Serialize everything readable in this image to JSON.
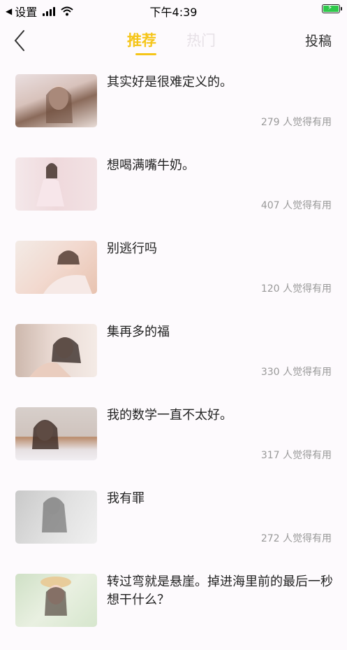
{
  "status_bar": {
    "back_app": "设置",
    "time": "下午4:39",
    "back_arrow": "◀"
  },
  "nav": {
    "tabs": [
      {
        "label": "推荐",
        "active": true
      },
      {
        "label": "热门",
        "active": false
      }
    ],
    "submit_label": "投稿",
    "back_icon": "chevron-left-icon",
    "accent_color": "#f5c518"
  },
  "posts": [
    {
      "title": "其实好是很难定义的。",
      "likes": "279 人觉得有用"
    },
    {
      "title": "想喝满嘴牛奶。",
      "likes": "407 人觉得有用"
    },
    {
      "title": "别逃行吗",
      "likes": "120 人觉得有用"
    },
    {
      "title": "集再多的福",
      "likes": "330 人觉得有用"
    },
    {
      "title": "我的数学一直不太好。",
      "likes": "317 人觉得有用"
    },
    {
      "title": "我有罪",
      "likes": "272 人觉得有用"
    },
    {
      "title": "转过弯就是悬崖。掉进海里前的最后一秒想干什么？",
      "likes": ""
    }
  ]
}
